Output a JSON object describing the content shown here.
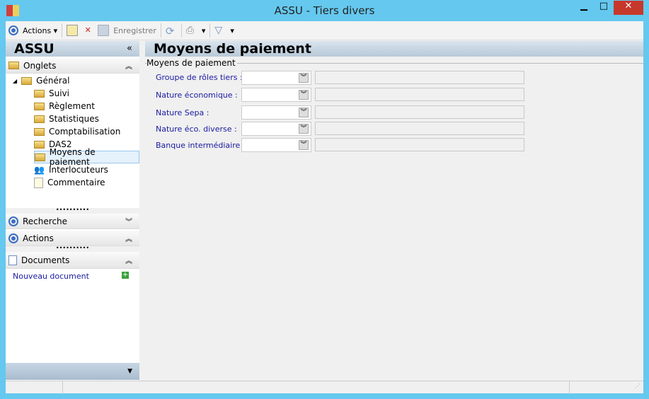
{
  "window": {
    "title": "ASSU -  Tiers divers",
    "minimize": "▁",
    "maximize": "□",
    "close": "✕"
  },
  "toolbar": {
    "actions": "Actions",
    "save": "Enregistrer"
  },
  "sidebar": {
    "title": "ASSU",
    "collapse": "«",
    "onglets": "Onglets",
    "tree": [
      {
        "label": "Général"
      },
      {
        "label": "Suivi"
      },
      {
        "label": "Règlement"
      },
      {
        "label": "Statistiques"
      },
      {
        "label": "Comptabilisation"
      },
      {
        "label": "DAS2"
      },
      {
        "label": "Moyens de paiement",
        "selected": true
      },
      {
        "label": "Interlocuteurs"
      },
      {
        "label": "Commentaire"
      }
    ],
    "recherche": "Recherche",
    "actions": "Actions",
    "documents": "Documents",
    "new_document": "Nouveau document"
  },
  "main": {
    "title": "Moyens de paiement",
    "group": "Moyens de paiement",
    "fields": [
      {
        "label": "Groupe de rôles tiers :",
        "value": "",
        "description": ""
      },
      {
        "label": "Nature économique :",
        "value": "",
        "description": ""
      },
      {
        "label": "Nature Sepa :",
        "value": "",
        "description": ""
      },
      {
        "label": "Nature éco. diverse :",
        "value": "",
        "description": ""
      },
      {
        "label": "Banque intermédiaire :",
        "value": "",
        "description": ""
      }
    ]
  }
}
